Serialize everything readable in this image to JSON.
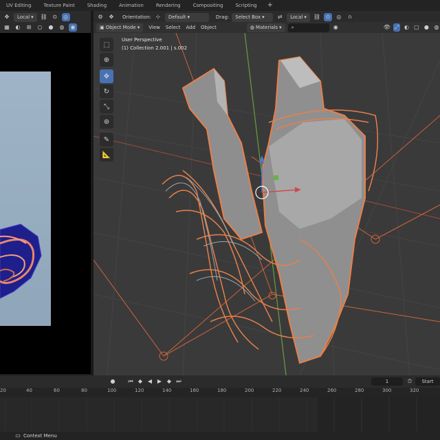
{
  "topbar": {
    "tabs": [
      "UV Editing",
      "Texture Paint",
      "Shading",
      "Animation",
      "Rendering",
      "Compositing",
      "Scripting",
      "+"
    ]
  },
  "left_header": {
    "transform_space": "Local"
  },
  "viewport_header": {
    "orientation_label": "Orientation:",
    "orientation_value": "Default",
    "drag_label": "Drag:",
    "drag_value": "Select Box",
    "pivot_value": "Local"
  },
  "viewport_menu": {
    "mode": "Object Mode",
    "view": "View",
    "select": "Select",
    "add": "Add",
    "object": "Object",
    "materials": "Materials"
  },
  "viewport_overlay": {
    "perspective": "User Perspective",
    "collection": "(1) Collection 2.001 | s.002"
  },
  "toolbar": {
    "icons": [
      "select-box-icon",
      "cursor-icon",
      "move-icon",
      "rotate-icon",
      "scale-icon",
      "transform-icon",
      "annotate-icon",
      "measure-icon"
    ],
    "active_index": 2
  },
  "timeline": {
    "current_frame": "1",
    "start_label": "Start",
    "ruler_ticks": [
      "20",
      "40",
      "60",
      "80",
      "100",
      "120",
      "140",
      "160",
      "180",
      "200",
      "220",
      "240",
      "260",
      "280",
      "300",
      "320"
    ]
  },
  "statusbar": {
    "context_menu": "Context Menu"
  },
  "colors": {
    "selection_outline": "#e8804a",
    "active_tool": "#4772b3",
    "viewport_bg": "#3a3a3a"
  }
}
